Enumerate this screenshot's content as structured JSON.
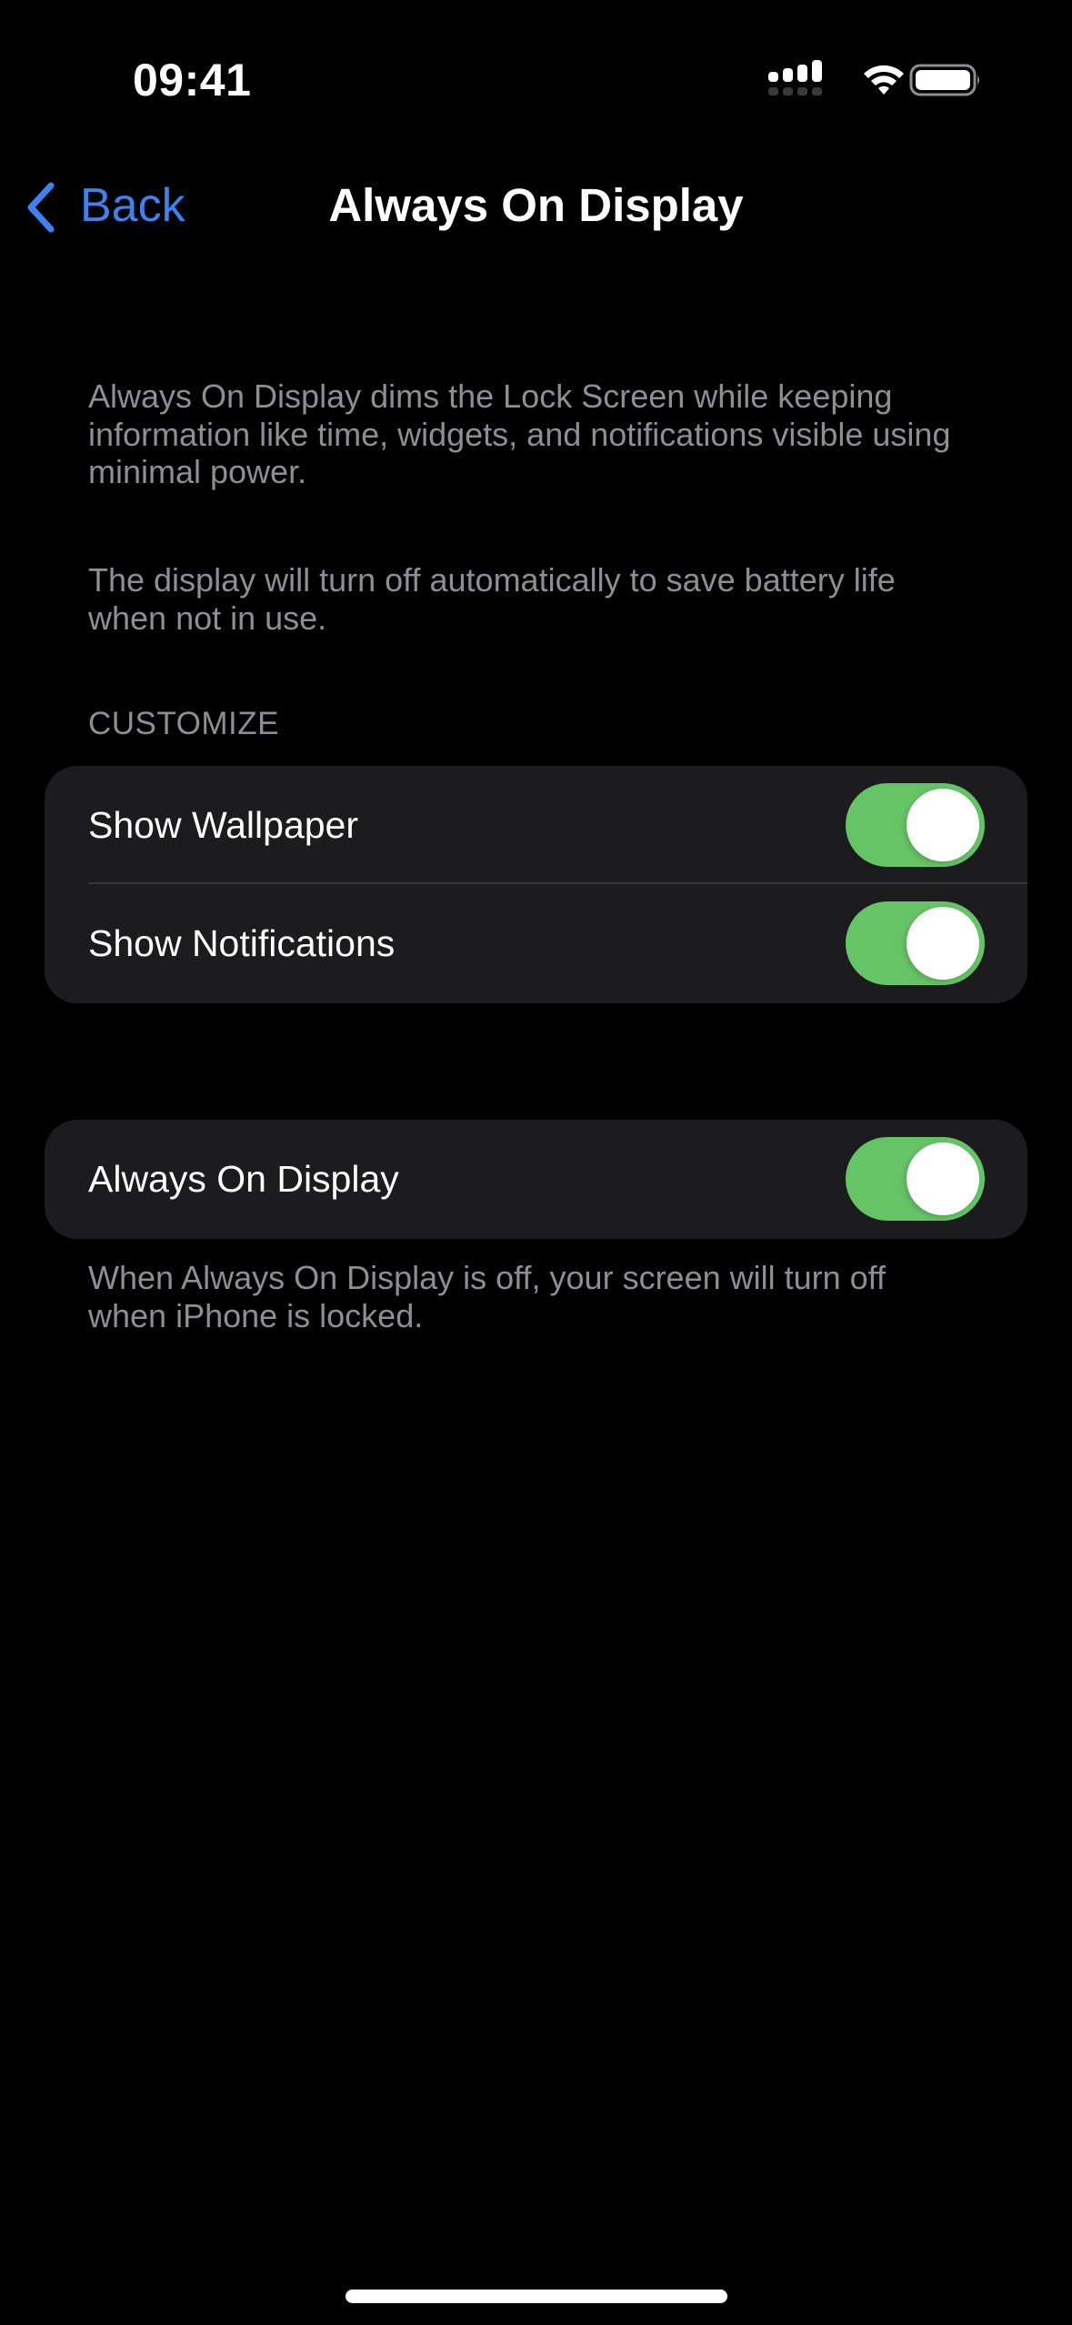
{
  "status_bar": {
    "time": "09:41",
    "icons": [
      "cellular-signal-icon",
      "wifi-icon",
      "battery-icon"
    ]
  },
  "nav": {
    "back_label": "Back",
    "back_icon": "chevron-left-icon",
    "title": "Always On Display"
  },
  "description": {
    "paragraph_1": "Always On Display dims the Lock Screen while keeping information like time, widgets, and notifications visible using minimal power.",
    "paragraph_2": "The display will turn off automatically to save battery life when not in use."
  },
  "customize_section": {
    "header": "CUSTOMIZE",
    "rows": [
      {
        "label": "Show Wallpaper",
        "toggle_on": true
      },
      {
        "label": "Show Notifications",
        "toggle_on": true
      }
    ]
  },
  "main_toggle_section": {
    "rows": [
      {
        "label": "Always On Display",
        "toggle_on": true
      }
    ],
    "footer": "When Always On Display is off, your screen will turn off when iPhone is locked."
  },
  "colors": {
    "accent_blue": "#3E82F0",
    "toggle_green": "#65C466",
    "card_background": "#1C1C1E",
    "secondary_text": "#8E8E93"
  }
}
